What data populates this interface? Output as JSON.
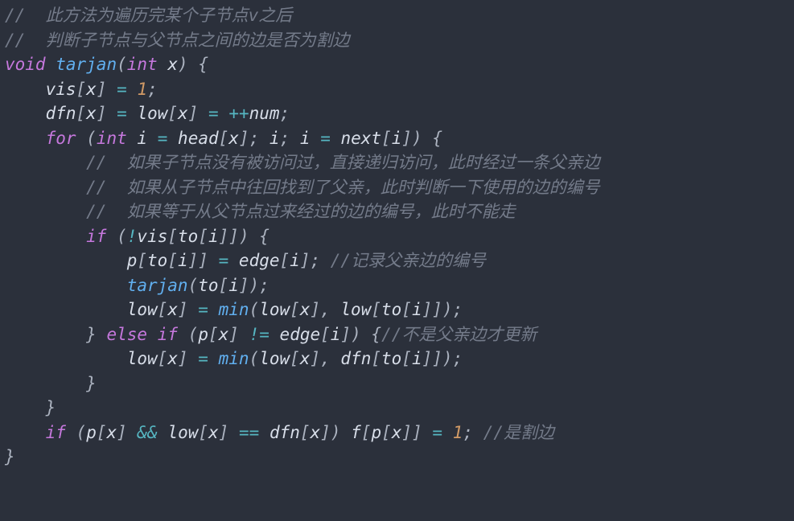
{
  "comments": {
    "c1": "//  此方法为遍历完某个子节点v之后",
    "c2": "//  判断子节点与父节点之间的边是否为割边",
    "c3": "//  如果子节点没有被访问过，直接递归访问，此时经过一条父亲边",
    "c4": "//  如果从子节点中往回找到了父亲，此时判断一下使用的边的编号",
    "c5": "//  如果等于从父节点过来经过的边的编号，此时不能走",
    "c6": "//记录父亲边的编号",
    "c7": "//不是父亲边才更新",
    "c8": "//是割边"
  },
  "kw": {
    "void": "void",
    "int": "int",
    "for": "for",
    "if": "if",
    "else": "else"
  },
  "fn": {
    "tarjan": "tarjan",
    "min": "min"
  },
  "id": {
    "x": "x",
    "vis": "vis",
    "dfn": "dfn",
    "low": "low",
    "num": "num",
    "i": "i",
    "head": "head",
    "next": "next",
    "to": "to",
    "p": "p",
    "edge": "edge",
    "f": "f"
  },
  "num": {
    "one": "1"
  },
  "op": {
    "assign": "=",
    "eq": "==",
    "neq": "!=",
    "preinc": "++",
    "not": "!",
    "and": "&&"
  },
  "pn": {
    "lparen": "(",
    "rparen": ")",
    "lbrace": "{",
    "rbrace": "}",
    "lbrack": "[",
    "rbrack": "]",
    "semi": ";",
    "comma": ","
  }
}
